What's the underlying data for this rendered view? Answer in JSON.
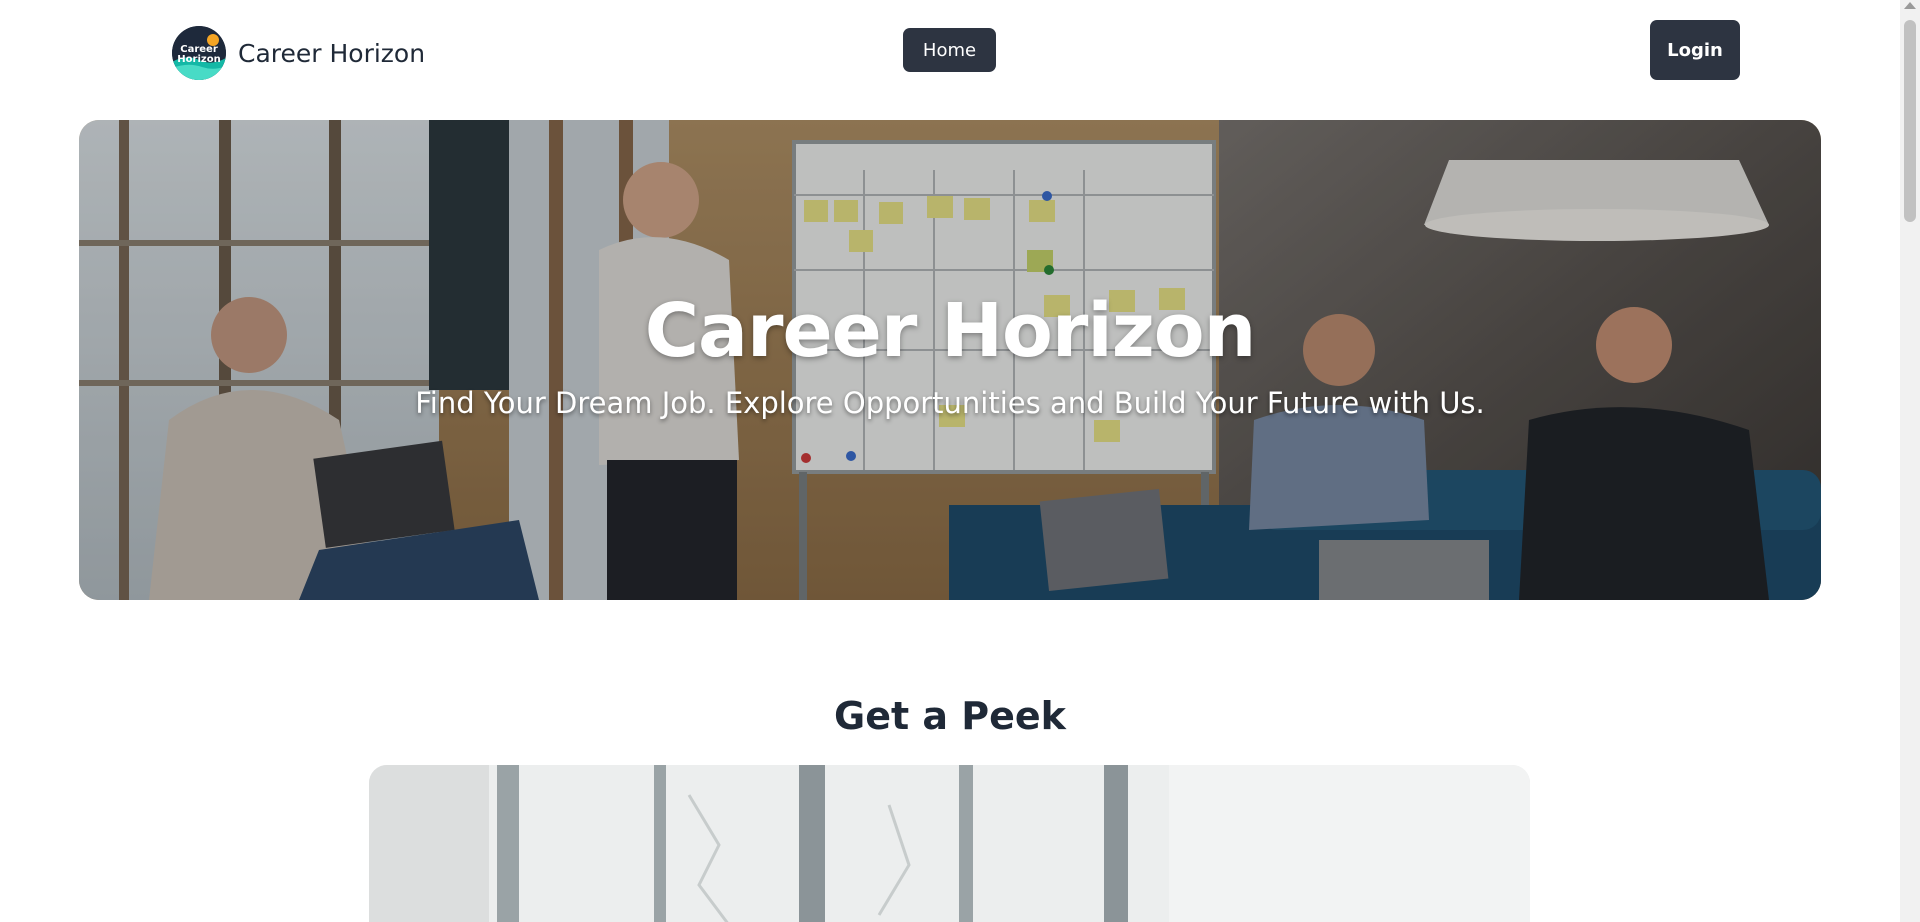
{
  "brand": {
    "logo_text_line1": "Career",
    "logo_text_line2": "Horizon",
    "name": "Career Horizon"
  },
  "nav": {
    "home_label": "Home",
    "login_label": "Login"
  },
  "hero": {
    "title": "Career Horizon",
    "subtitle": "Find Your Dream Job. Explore Opportunities and Build Your Future with Us."
  },
  "peek": {
    "title": "Get a Peek"
  },
  "colors": {
    "button_bg": "#2d3441",
    "text_dark": "#1f2937",
    "logo_bg": "#1e293b",
    "logo_teal": "#14b8a6",
    "logo_sun": "#f5a524"
  }
}
